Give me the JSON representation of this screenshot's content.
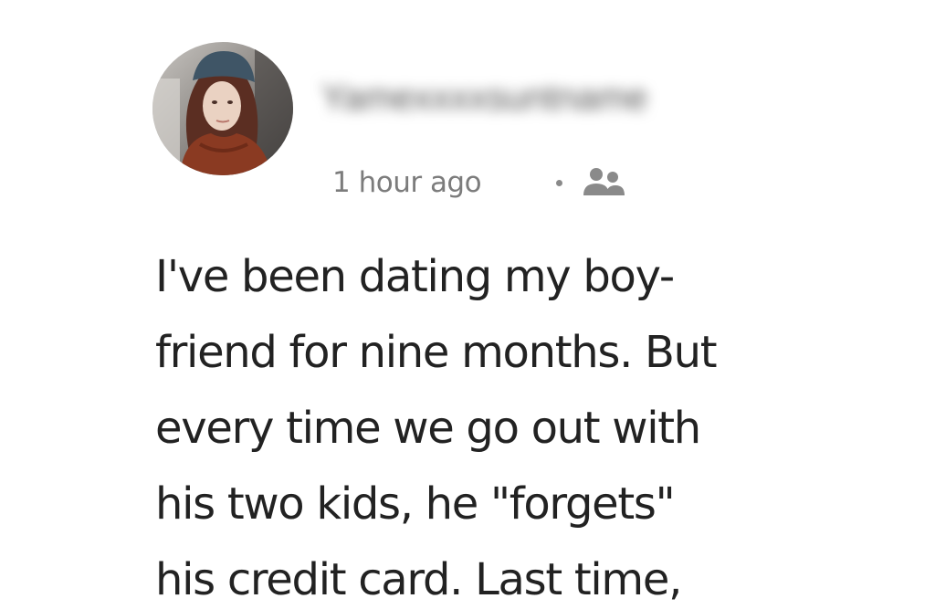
{
  "post": {
    "author": {
      "name": "Yamexxxxsuntname",
      "avatar_icon": "profile-photo-icon"
    },
    "timestamp": "1 hour ago",
    "audience_icon": "friends-icon",
    "text_lines": [
      "I've been dating my boy-",
      "friend for nine months. But",
      "every time we go out with",
      "his two kids, he \"forgets\"",
      "his credit card. Last time,"
    ]
  }
}
